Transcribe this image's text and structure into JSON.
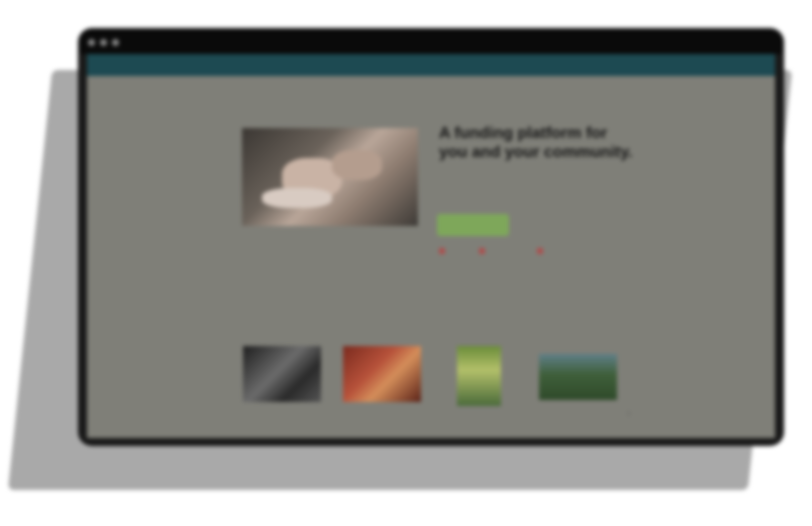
{
  "nav": {
    "logo": "",
    "links": [
      "",
      "",
      ""
    ],
    "right": ""
  },
  "hero": {
    "title": "A funding platform for you and your community.",
    "subtitle": "",
    "cta_label": "",
    "learn_link": ""
  },
  "social": [
    {
      "label": "",
      "color": "#b04a4a"
    },
    {
      "label": "",
      "color": "#b04a4a"
    },
    {
      "label": "",
      "color": "#b04a4a"
    }
  ],
  "stats": {
    "label": ""
  },
  "columns": [
    {
      "heading": "",
      "text": ""
    },
    {
      "heading": "",
      "text": ""
    },
    {
      "heading": "",
      "text": ""
    },
    {
      "heading": "",
      "text": ""
    }
  ],
  "featured": {
    "heading": "",
    "cards": [
      {
        "caption": "",
        "image": "bw-photo"
      },
      {
        "caption": "",
        "image": "red-photo"
      },
      {
        "caption": "",
        "image": "green-poster"
      },
      {
        "caption": "",
        "image": "landscape-photo"
      }
    ]
  },
  "colors": {
    "nav_bg": "#1d4a52",
    "screen_bg": "#7f7f78",
    "cta_bg": "#7ea75a",
    "link": "#3d5f7a"
  }
}
